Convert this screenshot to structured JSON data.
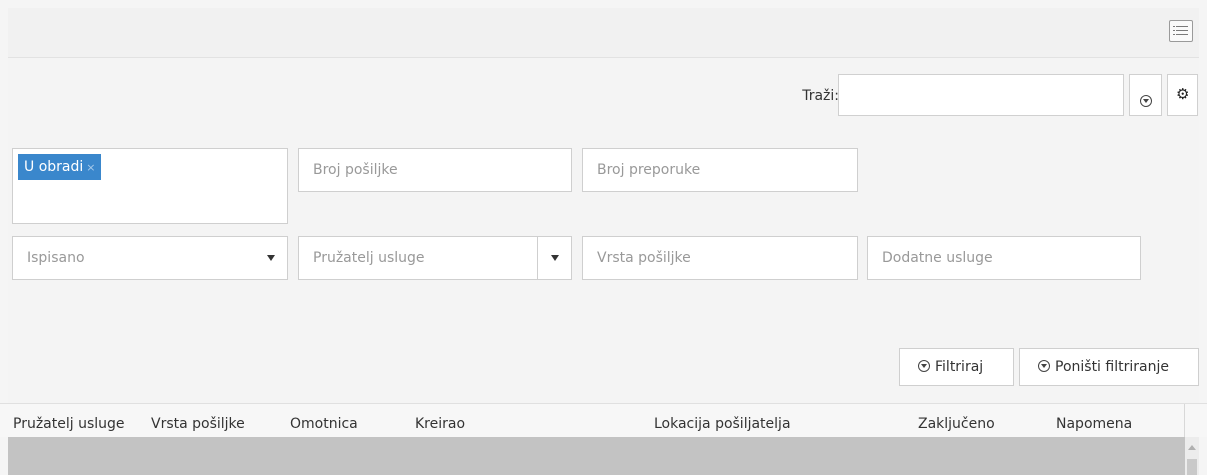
{
  "toolbar": {
    "view_icon": "list-view-icon"
  },
  "search": {
    "label": "Traži:",
    "value": "",
    "filter_icon": "filter-circle-icon",
    "settings_icon": "gear-icon"
  },
  "filters": {
    "status_tags": [
      {
        "label": "U obradi",
        "remove": "×"
      }
    ],
    "broj_posiljke": "Broj pošiljke",
    "broj_preporuke": "Broj preporuke",
    "ispisano": "Ispisano",
    "pruzatelj_usluge": "Pružatelj usluge",
    "vrsta_posiljke": "Vrsta pošiljke",
    "dodatne_usluge": "Dodatne usluge"
  },
  "actions": {
    "filter_label": "Filtriraj",
    "reset_label": "Poništi filtriranje"
  },
  "table": {
    "columns": [
      "Pružatelj usluge",
      "Vrsta pošiljke",
      "Omotnica",
      "Kreirao",
      "Lokacija pošiljatelja",
      "Zaključeno",
      "Napomena"
    ]
  }
}
